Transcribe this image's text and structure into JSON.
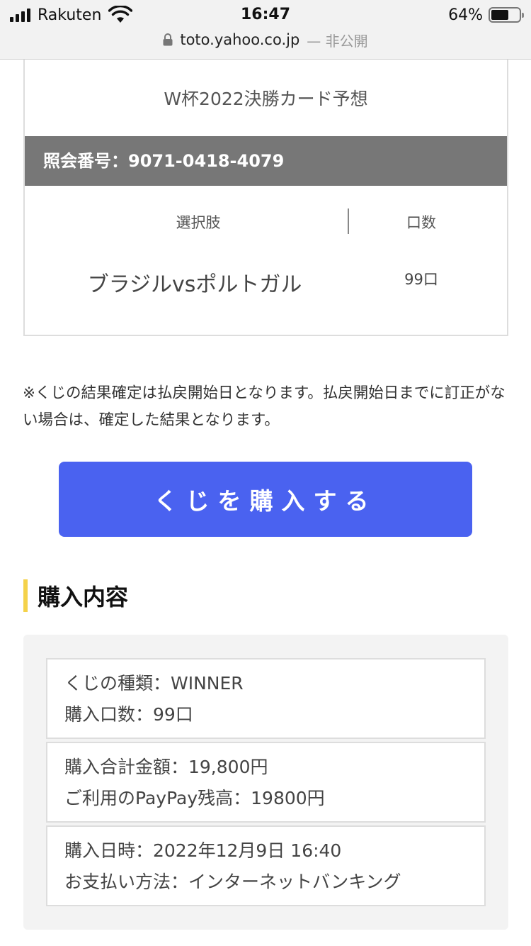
{
  "status_bar": {
    "carrier": "Rakuten",
    "time": "16:47",
    "battery_percent": "64%",
    "battery_level": 0.64,
    "url": "toto.yahoo.co.jp",
    "url_note": "— 非公開"
  },
  "card": {
    "title": "W杯2022決勝カード予想",
    "reference_label": "照会番号：9071-0418-4079",
    "columns": {
      "choice": "選択肢",
      "units": "口数"
    },
    "row": {
      "choice": "ブラジルvsポルトガル",
      "units": "99口"
    }
  },
  "note": "※くじの結果確定は払戻開始日となります。払戻開始日までに訂正がない場合は、確定した結果となります。",
  "buy_button": "くじを購入する",
  "purchase_section": {
    "title": "購入内容",
    "boxes": [
      {
        "line1": "くじの種類：WINNER",
        "line2": "購入口数：99口"
      },
      {
        "line1": "購入合計金額：19,800円",
        "line2": "ご利用のPayPay残高：19800円"
      },
      {
        "line1": "購入日時：2022年12月9日 16:40",
        "line2": "お支払い方法：インターネットバンキング"
      }
    ]
  },
  "colors": {
    "button": "#4a62f0",
    "reference_bar": "#777777",
    "section_accent": "#f4d24a"
  }
}
